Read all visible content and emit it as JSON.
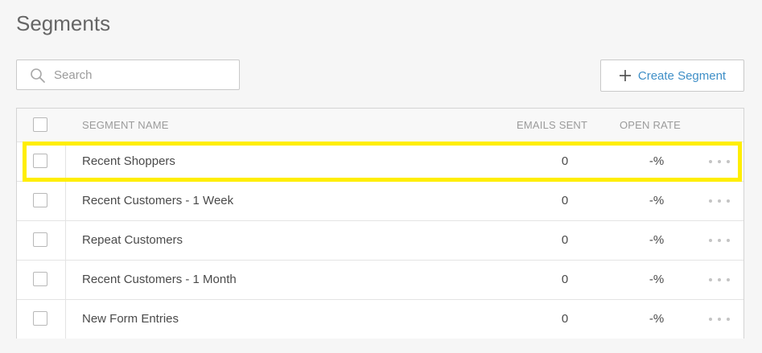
{
  "page": {
    "title": "Segments"
  },
  "search": {
    "placeholder": "Search",
    "value": "",
    "icon": "search-icon"
  },
  "toolbar": {
    "create_label": "Create Segment",
    "create_icon": "plus-icon"
  },
  "table": {
    "columns": {
      "name": "SEGMENT NAME",
      "sent": "EMAILS SENT",
      "rate": "OPEN RATE"
    },
    "rows": [
      {
        "name": "Recent Shoppers",
        "sent": "0",
        "rate": "-%"
      },
      {
        "name": "Recent Customers - 1 Week",
        "sent": "0",
        "rate": "-%"
      },
      {
        "name": "Repeat Customers",
        "sent": "0",
        "rate": "-%"
      },
      {
        "name": "Recent Customers - 1 Month",
        "sent": "0",
        "rate": "-%"
      },
      {
        "name": "New Form Entries",
        "sent": "0",
        "rate": "-%"
      }
    ],
    "row_menu_icon": "more-horizontal-icon"
  },
  "colors": {
    "accent": "#3f8fc7",
    "highlight": "#ffee00",
    "background": "#f6f6f6"
  }
}
